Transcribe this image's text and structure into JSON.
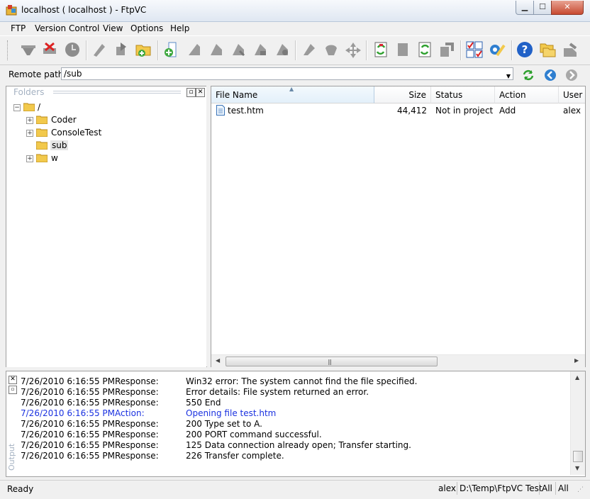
{
  "window": {
    "title": "localhost  ( localhost ) - FtpVC"
  },
  "menu": [
    "FTP",
    "Version Control",
    "View",
    "Options",
    "Help"
  ],
  "toolbar": {
    "icons": [
      "connect-icon",
      "disconnect-icon",
      "stop-icon",
      "get-latest-icon",
      "check-out-icon",
      "add-folder-icon",
      "add-file-icon",
      "check-in-icon",
      "undo-checkout-icon",
      "get-version-icon",
      "label-icon",
      "history-icon",
      "rename-icon",
      "delete-icon",
      "move-icon",
      "refresh-project-icon",
      "remove-icon",
      "sync-icon",
      "share-icon",
      "options-checklist-icon",
      "settings-icon",
      "help-icon",
      "folders-icon",
      "exit-icon"
    ]
  },
  "remote_path": {
    "label": "Remote path:",
    "value": "/sub"
  },
  "folders": {
    "title": "Folders",
    "root": "/",
    "items": [
      {
        "label": "Coder",
        "expandable": true
      },
      {
        "label": "ConsoleTest",
        "expandable": true
      },
      {
        "label": "sub",
        "expandable": false,
        "selected": true
      },
      {
        "label": "w",
        "expandable": true
      }
    ]
  },
  "file_list": {
    "columns": [
      "File Name",
      "Size",
      "Status",
      "Action",
      "User"
    ],
    "rows": [
      {
        "name": "test.htm",
        "size": "44,412",
        "status": "Not in project",
        "action": "Add",
        "user": "alex"
      }
    ]
  },
  "output": {
    "caption": "Output",
    "rows": [
      {
        "date": "7/26/2010 6:16:55 PM",
        "type": "Response:",
        "message": " Win32 error:   The system cannot find the file specified.",
        "kind": "response"
      },
      {
        "date": "7/26/2010 6:16:55 PM",
        "type": "Response:",
        "message": " Error details: File system returned an error.",
        "kind": "response"
      },
      {
        "date": "7/26/2010 6:16:55 PM",
        "type": "Response:",
        "message": "550 End",
        "kind": "response"
      },
      {
        "date": "7/26/2010 6:16:55 PM",
        "type": "Action:",
        "message": "Opening file test.htm",
        "kind": "action"
      },
      {
        "date": "7/26/2010 6:16:55 PM",
        "type": "Response:",
        "message": "200 Type set to A.",
        "kind": "response"
      },
      {
        "date": "7/26/2010 6:16:55 PM",
        "type": "Response:",
        "message": "200 PORT command successful.",
        "kind": "response"
      },
      {
        "date": "7/26/2010 6:16:55 PM",
        "type": "Response:",
        "message": "125 Data connection already open; Transfer starting.",
        "kind": "response"
      },
      {
        "date": "7/26/2010 6:16:55 PM",
        "type": "Response:",
        "message": "226 Transfer complete.",
        "kind": "response"
      }
    ]
  },
  "status": {
    "ready": "Ready",
    "user": "alex",
    "path": "D:\\Temp\\FtpVC Test",
    "filter1": "All",
    "filter2": "All"
  },
  "colors": {
    "action_text": "#1a31e0",
    "folder": "#f2c94c"
  }
}
